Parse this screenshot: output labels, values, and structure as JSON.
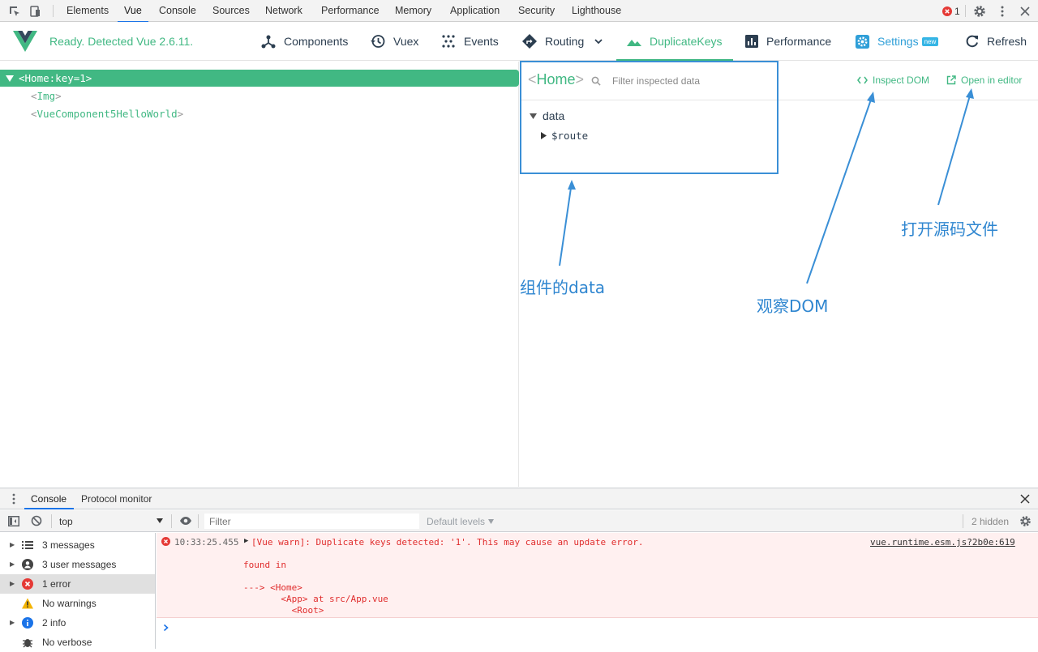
{
  "devtools": {
    "tabs": [
      "Elements",
      "Vue",
      "Console",
      "Sources",
      "Network",
      "Performance",
      "Memory",
      "Application",
      "Security",
      "Lighthouse"
    ],
    "active_tab": "Vue",
    "error_count": "1"
  },
  "vue_header": {
    "status": "Ready. Detected Vue 2.6.11.",
    "nav": [
      {
        "label": "Components",
        "icon": "components-icon"
      },
      {
        "label": "Vuex",
        "icon": "history-icon"
      },
      {
        "label": "Events",
        "icon": "events-icon"
      },
      {
        "label": "Routing",
        "icon": "routing-icon"
      },
      {
        "label": "DuplicateKeys",
        "icon": "mountain-icon"
      },
      {
        "label": "Performance",
        "icon": "bar-chart-icon"
      },
      {
        "label": "Settings",
        "icon": "gear-icon"
      },
      {
        "label": "Refresh",
        "icon": "refresh-icon"
      }
    ],
    "new_badge": "new",
    "accent": "#41b883"
  },
  "tree": {
    "selected": {
      "name": "Home",
      "attr": ":key=1"
    },
    "children": [
      "Img",
      "VueComponent5HelloWorld"
    ]
  },
  "inspector": {
    "title": "Home",
    "filter_placeholder": "Filter inspected data",
    "inspect_dom": "Inspect DOM",
    "open_in_editor": "Open in editor",
    "section": "data",
    "props": [
      "$route"
    ]
  },
  "annotations": {
    "data": "组件的data",
    "dom": "观察DOM",
    "editor": "打开源码文件"
  },
  "drawer": {
    "tabs": [
      "Console",
      "Protocol monitor"
    ],
    "context": "top",
    "filter_placeholder": "Filter",
    "levels": "Default levels",
    "hidden": "2 hidden",
    "sidebar": [
      {
        "label": "3 messages",
        "icon": "list-icon"
      },
      {
        "label": "3 user messages",
        "icon": "user-icon"
      },
      {
        "label": "1 error",
        "icon": "error-icon"
      },
      {
        "label": "No warnings",
        "icon": "warning-icon"
      },
      {
        "label": "2 info",
        "icon": "info-icon"
      },
      {
        "label": "No verbose",
        "icon": "bug-icon"
      }
    ],
    "message": {
      "time": "10:33:25.455",
      "text": "[Vue warn]: Duplicate keys detected: '1'. This may cause an update error.",
      "source": "vue.runtime.esm.js?2b0e:619",
      "found": "found in",
      "trace1": "---> <Home>",
      "trace2": "       <App> at src/App.vue",
      "trace3": "         <Root>"
    }
  }
}
